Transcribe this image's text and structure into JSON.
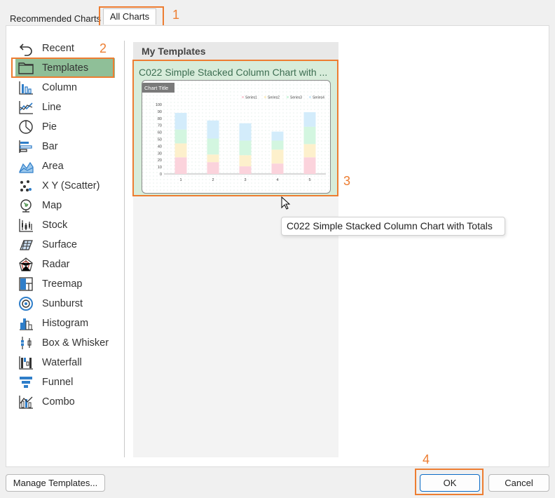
{
  "tabs": {
    "recommended": "Recommended Charts",
    "all": "All Charts"
  },
  "callouts": [
    "1",
    "2",
    "3",
    "4"
  ],
  "chart_types": [
    {
      "label": "Recent",
      "icon": "undo-icon"
    },
    {
      "label": "Templates",
      "icon": "folder-icon"
    },
    {
      "label": "Column",
      "icon": "column-chart-icon"
    },
    {
      "label": "Line",
      "icon": "line-chart-icon"
    },
    {
      "label": "Pie",
      "icon": "pie-chart-icon"
    },
    {
      "label": "Bar",
      "icon": "bar-chart-icon"
    },
    {
      "label": "Area",
      "icon": "area-chart-icon"
    },
    {
      "label": "X Y (Scatter)",
      "icon": "scatter-chart-icon"
    },
    {
      "label": "Map",
      "icon": "map-chart-icon"
    },
    {
      "label": "Stock",
      "icon": "stock-chart-icon"
    },
    {
      "label": "Surface",
      "icon": "surface-chart-icon"
    },
    {
      "label": "Radar",
      "icon": "radar-chart-icon"
    },
    {
      "label": "Treemap",
      "icon": "treemap-chart-icon"
    },
    {
      "label": "Sunburst",
      "icon": "sunburst-chart-icon"
    },
    {
      "label": "Histogram",
      "icon": "histogram-chart-icon"
    },
    {
      "label": "Box & Whisker",
      "icon": "box-whisker-chart-icon"
    },
    {
      "label": "Waterfall",
      "icon": "waterfall-chart-icon"
    },
    {
      "label": "Funnel",
      "icon": "funnel-chart-icon"
    },
    {
      "label": "Combo",
      "icon": "combo-chart-icon"
    }
  ],
  "selected_type": "Templates",
  "my_templates": {
    "header": "My Templates",
    "item_title": "C022 Simple Stacked Column Chart with ...",
    "tooltip": "C022 Simple Stacked Column Chart with Totals"
  },
  "buttons": {
    "manage_templates": "Manage Templates...",
    "ok": "OK",
    "cancel": "Cancel"
  },
  "colors": {
    "accent_orange": "#ed7d31",
    "selection_green": "#8fbf98",
    "template_bg": "#d7ecda"
  },
  "chart_data": {
    "type": "bar",
    "stacked": true,
    "title": "Chart Title",
    "categories": [
      "1",
      "2",
      "3",
      "4",
      "5"
    ],
    "series": [
      {
        "name": "Series1",
        "values": [
          24,
          17,
          11,
          15,
          24
        ],
        "color": "#fbd3dc"
      },
      {
        "name": "Series2",
        "values": [
          20,
          11,
          16,
          20,
          19
        ],
        "color": "#fdf0cc"
      },
      {
        "name": "Series3",
        "values": [
          20,
          23,
          21,
          13,
          25
        ],
        "color": "#d3f6e0"
      },
      {
        "name": "Series4",
        "values": [
          24,
          26,
          25,
          13,
          21
        ],
        "color": "#d3ecfb"
      }
    ],
    "ylim": [
      0,
      100
    ],
    "yticks": [
      "0",
      "10",
      "20",
      "30",
      "40",
      "50",
      "60",
      "70",
      "80",
      "90",
      "100"
    ],
    "legend": "top-right"
  }
}
